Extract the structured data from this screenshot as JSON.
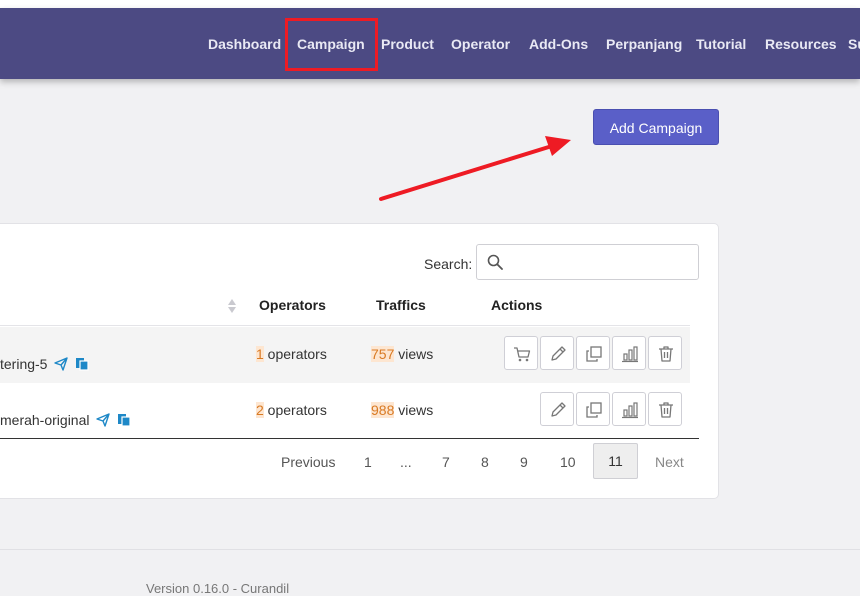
{
  "nav": {
    "items": [
      "Dashboard",
      "Campaign",
      "Product",
      "Operator",
      "Add-Ons",
      "Perpanjang",
      "Tutorial",
      "Resources",
      "Su"
    ]
  },
  "actions": {
    "add_campaign": "Add Campaign"
  },
  "table": {
    "search_label": "Search:",
    "search_value": "",
    "headers": {
      "operators": "Operators",
      "traffics": "Traffics",
      "actions": "Actions"
    },
    "rows": [
      {
        "name": "tering-5",
        "operators_count": "1",
        "operators_text": " operators",
        "traffic_count": "757",
        "traffic_text": " views"
      },
      {
        "name": "merah-original",
        "operators_count": "2",
        "operators_text": " operators",
        "traffic_count": "988",
        "traffic_text": " views"
      }
    ]
  },
  "pagination": {
    "previous": "Previous",
    "pages": [
      "1",
      "...",
      "7",
      "8",
      "9",
      "10"
    ],
    "current": "11",
    "next": "Next"
  },
  "footer": {
    "text": "Version 0.16.0 - Curandil"
  },
  "colors": {
    "navbar": "#4c4a83",
    "accent": "#5a5fc8",
    "annotation": "#ee1b24",
    "badge": "#fde6d1"
  },
  "icons": [
    "search-icon",
    "sort-icon",
    "share-icon",
    "copy-icon",
    "cart-icon",
    "pencil-icon",
    "duplicate-icon",
    "chart-icon",
    "trash-icon"
  ]
}
